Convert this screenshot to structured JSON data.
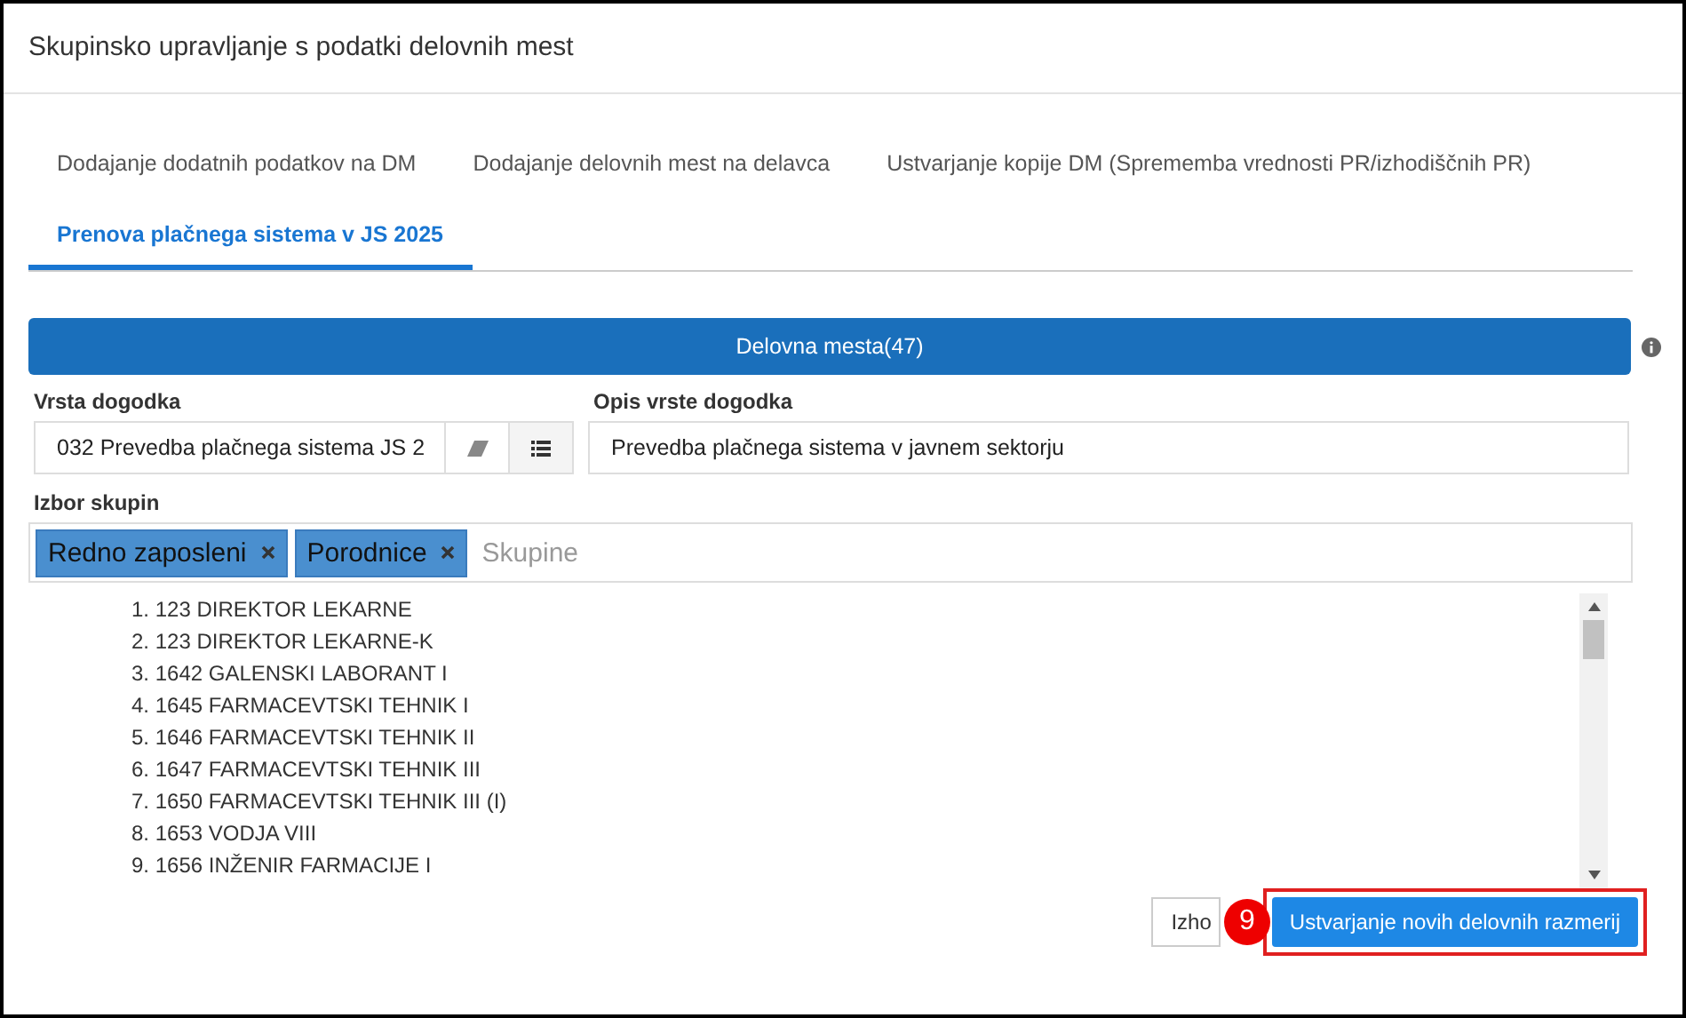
{
  "dialog": {
    "title": "Skupinsko upravljanje s podatki delovnih mest"
  },
  "tabs": [
    {
      "label": "Dodajanje dodatnih podatkov na DM",
      "selected": false
    },
    {
      "label": "Dodajanje delovnih mest na delavca",
      "selected": false
    },
    {
      "label": "Ustvarjanje kopije DM (Sprememba vrednosti PR/izhodiščnih PR)",
      "selected": false
    },
    {
      "label": "Prenova plačnega sistema v JS 2025",
      "selected": true
    }
  ],
  "section_bar": {
    "label": "Delovna mesta(47)"
  },
  "event_type": {
    "label": "Vrsta dogodka",
    "value": "032 Prevedba plačnega sistema JS 2"
  },
  "event_description": {
    "label": "Opis vrste dogodka",
    "value": "Prevedba plačnega sistema v javnem sektorju"
  },
  "groups": {
    "label": "Izbor skupin",
    "tags": [
      "Redno zaposleni",
      "Porodnice"
    ],
    "placeholder": "Skupine"
  },
  "positions": [
    "1. 123 DIREKTOR LEKARNE",
    "2. 123 DIREKTOR LEKARNE-K",
    "3. 1642 GALENSKI LABORANT I",
    "4. 1645 FARMACEVTSKI TEHNIK I",
    "5. 1646 FARMACEVTSKI TEHNIK II",
    "6. 1647 FARMACEVTSKI TEHNIK III",
    "7. 1650 FARMACEVTSKI TEHNIK III (I)",
    "8. 1653 VODJA VIII",
    "9. 1656 INŽENIR FARMACIJE I"
  ],
  "footer": {
    "exit_button": "Izho",
    "step_badge": "9",
    "primary_button": "Ustvarjanje novih delovnih razmerij"
  }
}
